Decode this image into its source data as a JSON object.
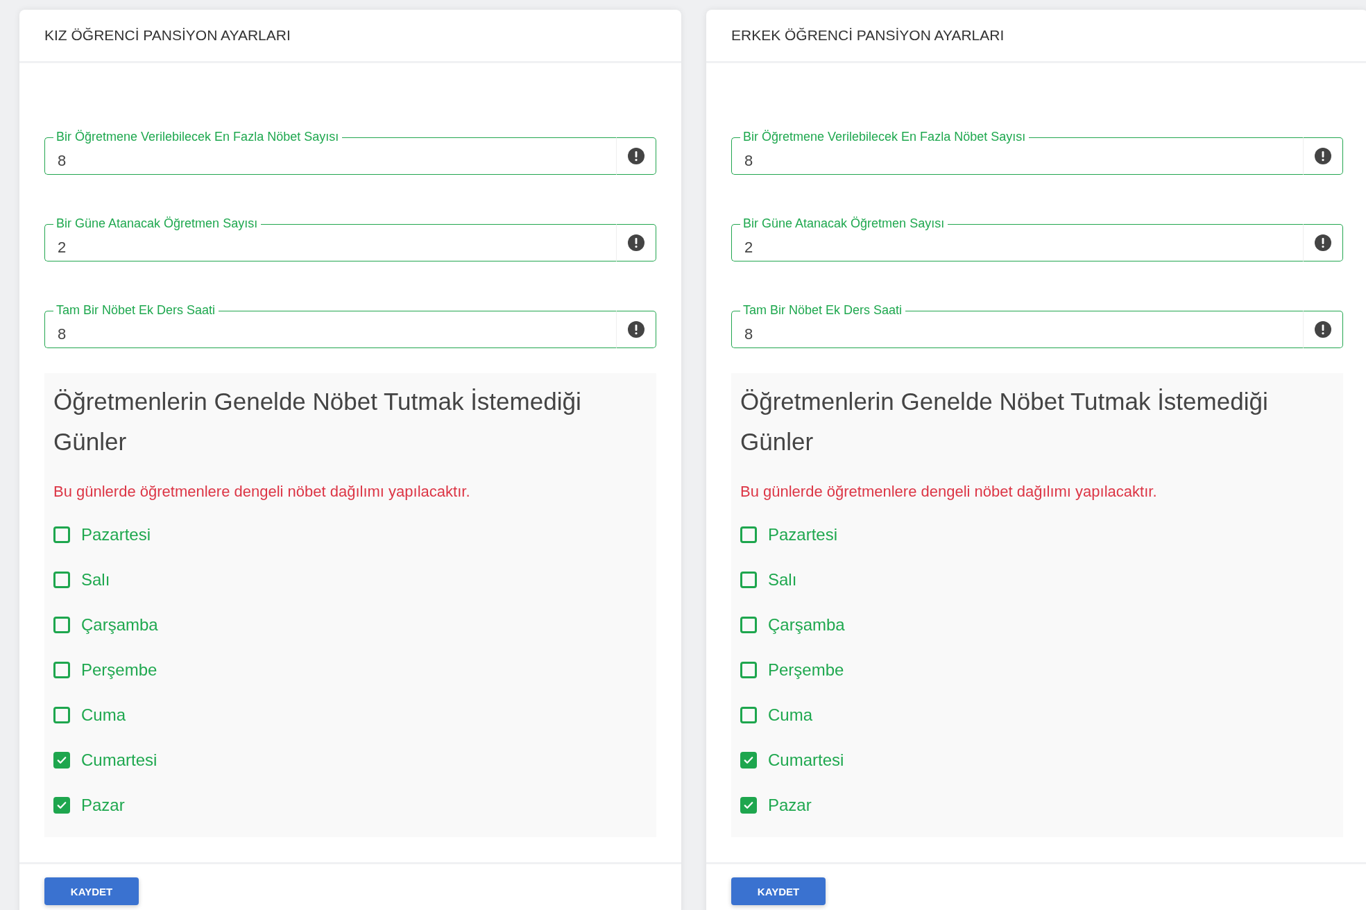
{
  "panels": [
    {
      "title": "KIZ ÖĞRENCİ PANSİYON AYARLARI",
      "fields": [
        {
          "label": "Bir Öğretmene Verilebilecek En Fazla Nöbet Sayısı",
          "value": "8"
        },
        {
          "label": "Bir Güne Atanacak Öğretmen Sayısı",
          "value": "2"
        },
        {
          "label": "Tam Bir Nöbet Ek Ders Saati",
          "value": "8"
        }
      ],
      "days_section": {
        "heading": "Öğretmenlerin Genelde Nöbet Tutmak İstemediği Günler",
        "note": "Bu günlerde öğretmenlere dengeli nöbet dağılımı yapılacaktır.",
        "days": [
          {
            "label": "Pazartesi",
            "checked": false
          },
          {
            "label": "Salı",
            "checked": false
          },
          {
            "label": "Çarşamba",
            "checked": false
          },
          {
            "label": "Perşembe",
            "checked": false
          },
          {
            "label": "Cuma",
            "checked": false
          },
          {
            "label": "Cumartesi",
            "checked": true
          },
          {
            "label": "Pazar",
            "checked": true
          }
        ]
      },
      "button": "KAYDET"
    },
    {
      "title": "ERKEK ÖĞRENCİ PANSİYON AYARLARI",
      "fields": [
        {
          "label": "Bir Öğretmene Verilebilecek En Fazla Nöbet Sayısı",
          "value": "8"
        },
        {
          "label": "Bir Güne Atanacak Öğretmen Sayısı",
          "value": "2"
        },
        {
          "label": "Tam Bir Nöbet Ek Ders Saati",
          "value": "8"
        }
      ],
      "days_section": {
        "heading": "Öğretmenlerin Genelde Nöbet Tutmak İstemediği Günler",
        "note": "Bu günlerde öğretmenlere dengeli nöbet dağılımı yapılacaktır.",
        "days": [
          {
            "label": "Pazartesi",
            "checked": false
          },
          {
            "label": "Salı",
            "checked": false
          },
          {
            "label": "Çarşamba",
            "checked": false
          },
          {
            "label": "Perşembe",
            "checked": false
          },
          {
            "label": "Cuma",
            "checked": false
          },
          {
            "label": "Cumartesi",
            "checked": true
          },
          {
            "label": "Pazar",
            "checked": true
          }
        ]
      },
      "button": "KAYDET"
    }
  ]
}
